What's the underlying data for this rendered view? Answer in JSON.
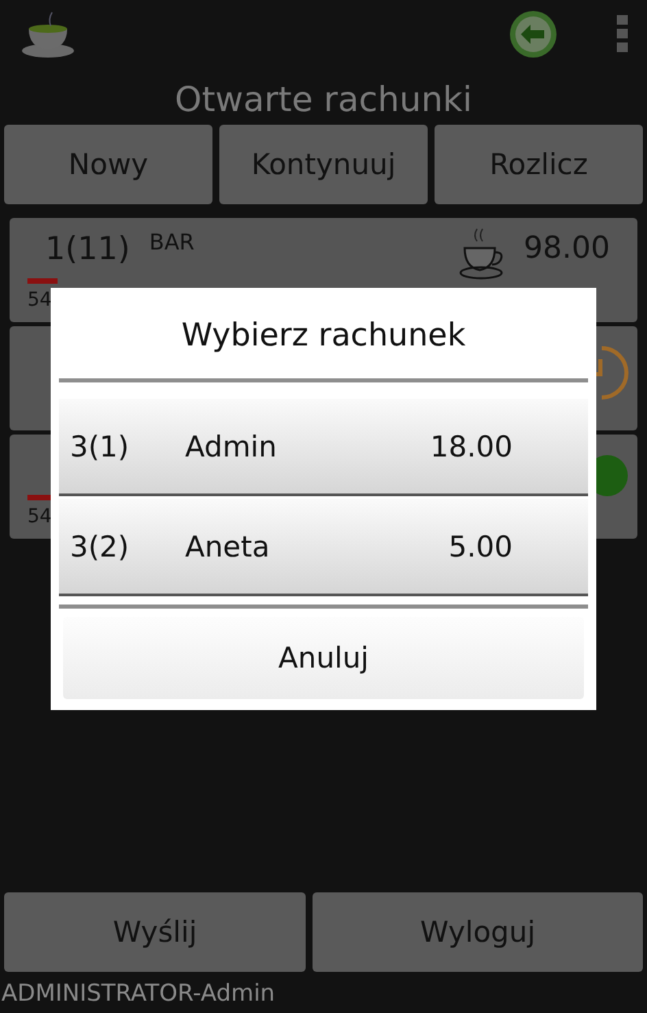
{
  "title": "Otwarte rachunki",
  "actions": [
    "Nowy",
    "Kontynuuj",
    "Rozlicz"
  ],
  "bills": [
    {
      "kind": "cup",
      "number": "1(11)",
      "label": "BAR",
      "amount": "98.00",
      "time": "54"
    },
    {
      "kind": "clock"
    },
    {
      "kind": "dot",
      "time": "54"
    }
  ],
  "dialog": {
    "title": "Wybierz rachunek",
    "items": [
      {
        "number": "3(1)",
        "name": "Admin",
        "amount": "18.00"
      },
      {
        "number": "3(2)",
        "name": "Aneta",
        "amount": "5.00"
      }
    ],
    "cancel": "Anuluj"
  },
  "bottom_buttons": [
    "Wyślij",
    "Wyloguj"
  ],
  "status_bar": "ADMINISTRATOR-Admin"
}
